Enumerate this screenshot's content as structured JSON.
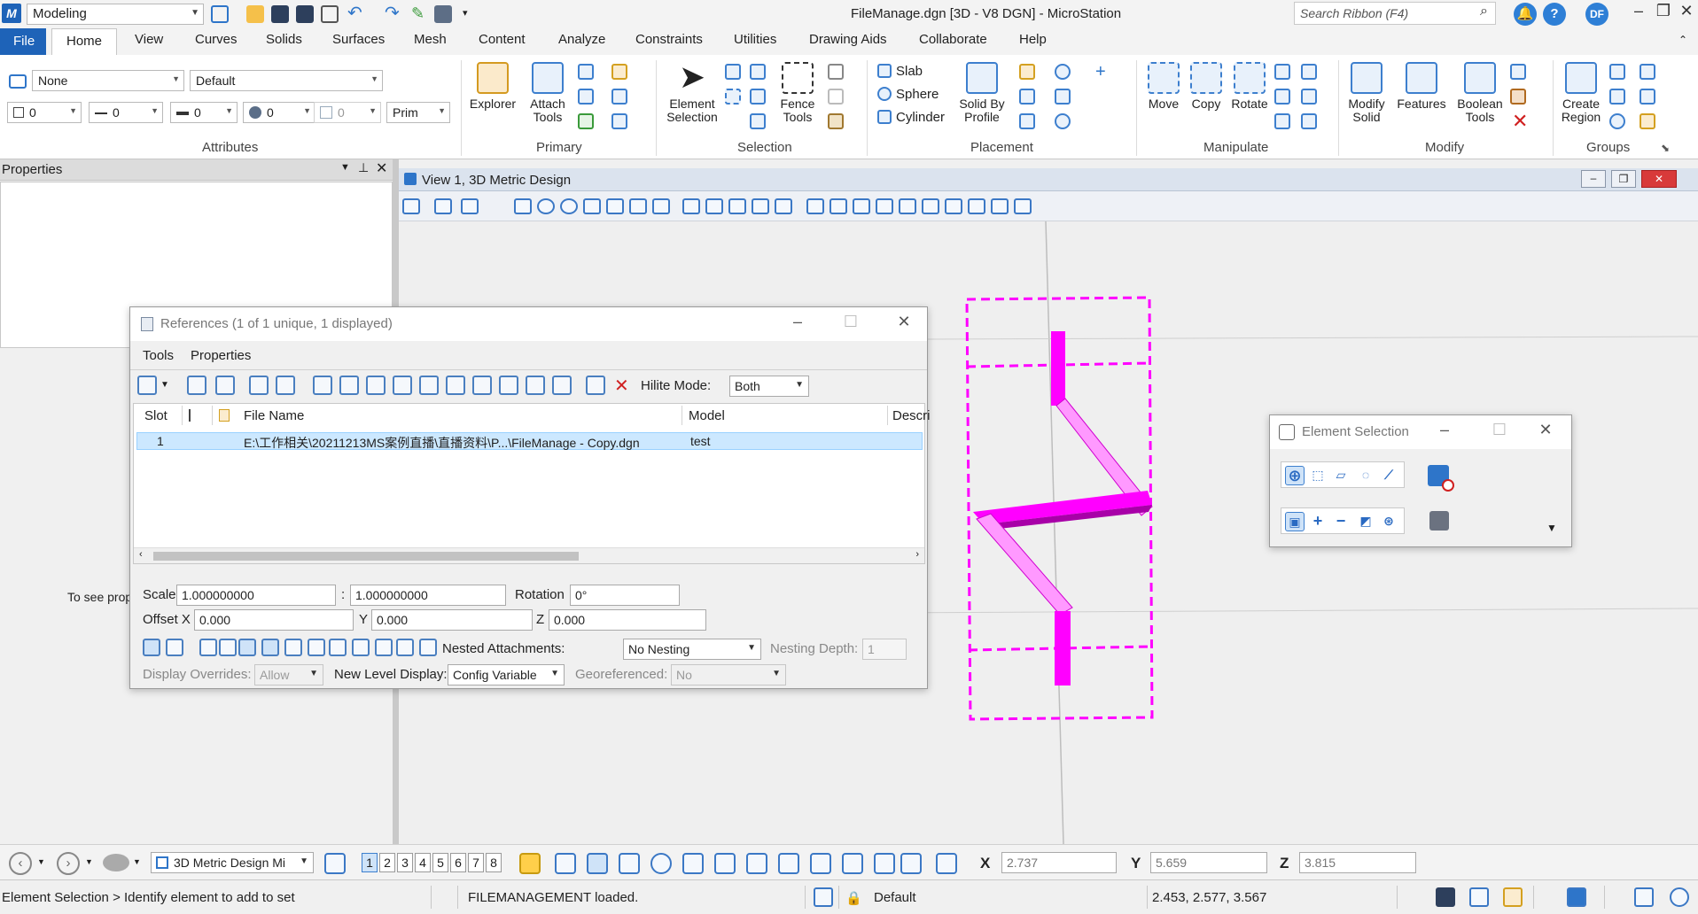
{
  "titlebar": {
    "workspace": "Modeling",
    "window_title": "FileManage.dgn [3D - V8 DGN] - MicroStation",
    "search_placeholder": "Search Ribbon (F4)",
    "user_initials": "DF",
    "help": "?"
  },
  "tabs": [
    "File",
    "Home",
    "View",
    "Curves",
    "Solids",
    "Surfaces",
    "Mesh",
    "Content",
    "Analyze",
    "Constraints",
    "Utilities",
    "Drawing Aids",
    "Collaborate",
    "Help"
  ],
  "ribbon": {
    "attributes": {
      "level": "None",
      "style": "Default",
      "color": "0",
      "linestyle": "0",
      "weight": "0",
      "transparency": "0",
      "priority_value": "0",
      "class": "Prim",
      "group_label": "Attributes"
    },
    "primary": {
      "explorer": "Explorer",
      "attach_tools": "Attach Tools",
      "group_label": "Primary"
    },
    "selection": {
      "element_selection": "Element Selection",
      "fence_tools": "Fence Tools",
      "group_label": "Selection"
    },
    "placement": {
      "slab": "Slab",
      "sphere": "Sphere",
      "cylinder": "Cylinder",
      "solid_by_profile": "Solid By Profile",
      "group_label": "Placement"
    },
    "manipulate": {
      "move": "Move",
      "copy": "Copy",
      "rotate": "Rotate",
      "group_label": "Manipulate"
    },
    "modify": {
      "modify_solid": "Modify Solid",
      "features": "Features",
      "boolean_tools": "Boolean Tools",
      "group_label": "Modify"
    },
    "groups": {
      "create_region": "Create Region",
      "group_label": "Groups"
    }
  },
  "properties_panel": {
    "title": "Properties",
    "hint": "To see prop"
  },
  "view": {
    "title": "View 1, 3D Metric Design"
  },
  "references": {
    "title": "References (1 of 1 unique, 1 displayed)",
    "menu": [
      "Tools",
      "Properties"
    ],
    "hilite_label": "Hilite Mode:",
    "hilite_value": "Both",
    "columns": [
      "Slot",
      "File Name",
      "Model",
      "Descri"
    ],
    "rows": [
      {
        "slot": "1",
        "file_name": "E:\\工作相关\\20211213MS案例直播\\直播资料\\P...\\FileManage - Copy.dgn",
        "model": "test"
      }
    ],
    "scale_label": "Scale",
    "scale_1": "1.000000000",
    "scale_sep": ":",
    "scale_2": "1.000000000",
    "rotation_label": "Rotation",
    "rotation": "0°",
    "offset_x_label": "Offset X",
    "offset_x": "0.000",
    "offset_y_label": "Y",
    "offset_y": "0.000",
    "offset_z_label": "Z",
    "offset_z": "0.000",
    "nested_label": "Nested Attachments:",
    "nested_value": "No Nesting",
    "nesting_depth_label": "Nesting Depth:",
    "nesting_depth": "1",
    "display_overrides_label": "Display Overrides:",
    "display_overrides": "Allow",
    "new_level_label": "New Level Display:",
    "new_level_value": "Config Variable",
    "georef_label": "Georeferenced:",
    "georef_value": "No"
  },
  "element_selection": {
    "title": "Element Selection"
  },
  "bottombar": {
    "model_combo": "3D Metric Design Mi",
    "views": [
      "1",
      "2",
      "3",
      "4",
      "5",
      "6",
      "7",
      "8"
    ],
    "active_view": "1",
    "x_label": "X",
    "x": "2.737",
    "y_label": "Y",
    "y": "5.659",
    "z_label": "Z",
    "z": "3.815"
  },
  "statusbar": {
    "prompt": "Element Selection > Identify element to add to set",
    "message": "FILEMANAGEMENT loaded.",
    "level": "Default",
    "coords": "2.453, 2.577, 3.567"
  },
  "colors": {
    "accent": "#1e63b8",
    "element": "#ff00ff",
    "element_dark": "#b000b0",
    "element_light": "#ff99ff"
  }
}
